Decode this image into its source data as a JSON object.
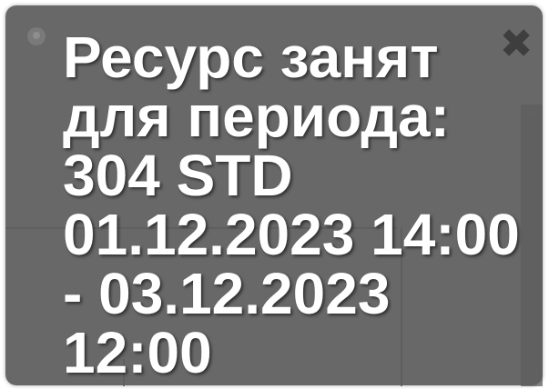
{
  "toast": {
    "lines": [
      "Ресурс занят",
      "для периода:",
      "304 STD",
      "01.12.2023 14:00",
      "- 03.12.2023",
      "12:00"
    ],
    "close_icon_glyph": "✖",
    "status_icon": "info-dot-icon"
  },
  "scrollbar": {
    "up_arrow_glyph": "^"
  },
  "colors": {
    "toast_background": "#5c5c5c",
    "toast_text": "#ffffff",
    "close_icon": "#3e3e3e",
    "grid_line": "#6f7f93"
  }
}
